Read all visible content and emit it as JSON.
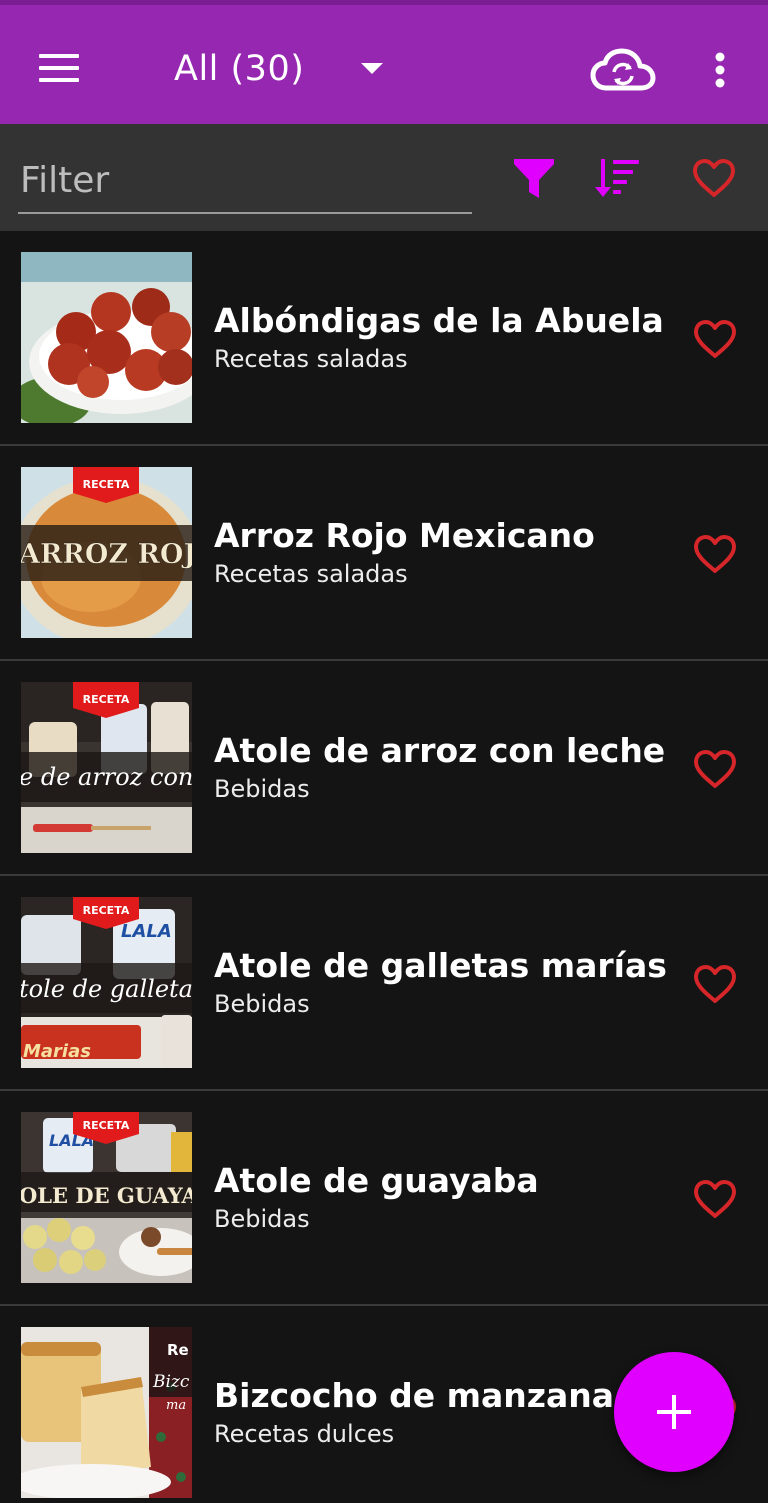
{
  "appbar": {
    "title": "All (30)",
    "icons": [
      "menu-icon",
      "dropdown-arrow-icon",
      "cloud-sync-icon",
      "more-vert-icon"
    ]
  },
  "filter": {
    "placeholder": "Filter",
    "value": "",
    "icons": [
      "funnel-icon",
      "sort-icon",
      "heart-outline-icon"
    ]
  },
  "colors": {
    "appbar": "#9527b1",
    "accent": "#e000ff",
    "favorite": "#d6262a",
    "background": "#141414",
    "filterbar": "#333333"
  },
  "recipes": [
    {
      "title": "Albóndigas de la Abuela",
      "category": "Recetas saladas",
      "thumb": "meatballs"
    },
    {
      "title": "Arroz Rojo Mexicano",
      "category": "Recetas saladas",
      "thumb_badge": "RECETA",
      "thumb_text": "ARROZ ROJ"
    },
    {
      "title": "Atole de arroz con leche",
      "category": "Bebidas",
      "thumb_badge": "RECETA",
      "thumb_text": "e de arroz con l"
    },
    {
      "title": "Atole de galletas marías",
      "category": "Bebidas",
      "thumb_badge": "RECETA",
      "thumb_text": "tole de galleta",
      "thumb_brand": "LALA",
      "thumb_brand2": "Marias"
    },
    {
      "title": "Atole de guayaba",
      "category": "Bebidas",
      "thumb_badge": "RECETA",
      "thumb_text": "OLE DE GUAYA",
      "thumb_brand": "LALA"
    },
    {
      "title": "Bizcocho de manzana",
      "category": "Recetas dulces",
      "thumb_text": "Bizc",
      "thumb_text2": "Re",
      "thumb_text3": "ma"
    }
  ],
  "fab": {
    "icon": "plus-icon"
  }
}
